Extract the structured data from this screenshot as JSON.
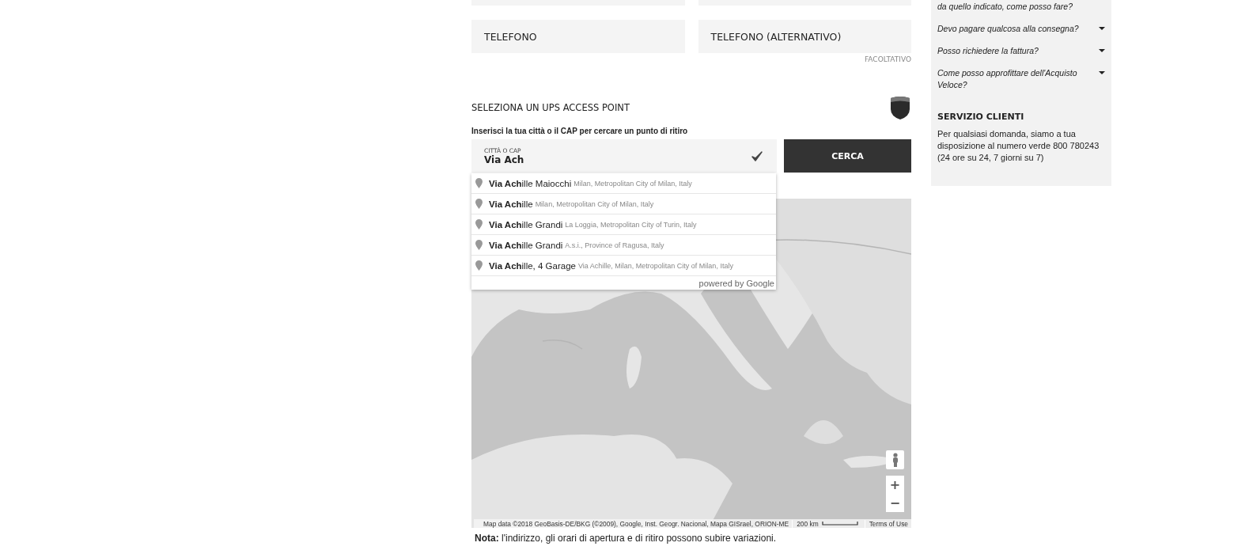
{
  "phone_fields": [
    {
      "label": "TELEFONO"
    },
    {
      "label": "TELEFONO (ALTERNATIVO)",
      "note": "FACOLTATIVO"
    }
  ],
  "access_point": {
    "title": "SELEZIONA UN UPS ACCESS POINT",
    "hint": "Inserisci la tua città o il CAP per cercare un punto di ritiro",
    "field_label": "CITTÀ O CAP",
    "field_value": "Via Ach",
    "valid": true,
    "button": "CERCA"
  },
  "suggestions": [
    {
      "main": "**Via Ach**ille Maiocchi",
      "secondary": "Milan, Metropolitan City of Milan, Italy"
    },
    {
      "main": "**Via Ach**ille",
      "secondary": "Milan, Metropolitan City of Milan, Italy"
    },
    {
      "main": "**Via Ach**ille Grandi",
      "secondary": "La Loggia, Metropolitan City of Turin, Italy"
    },
    {
      "main": "**Via Ach**ille Grandi",
      "secondary": "A.s.i., Province of Ragusa, Italy"
    },
    {
      "main": "**Via Ach**ille, 4 Garage",
      "secondary": "Via Achille, Milan, Metropolitan City of Milan, Italy"
    }
  ],
  "powered_by": "powered by Google",
  "map": {
    "kind": "picture",
    "zoom_in": "+",
    "zoom_out": "−",
    "attribution": "Map data ©2018 GeoBasis-DE/BKG (©2009), Google, Inst. Geogr. Nacional, Mapa GISrael, ORION-ME",
    "scale": "200 km",
    "terms": "Terms of Use"
  },
  "note": "**Nota:** l'indirizzo, gli orari di apertura e di ritiro possono subire variazioni.",
  "sidebar": {
    "faq": [
      {
        "question": "da quello indicato, come posso fare?",
        "expandable": false
      },
      {
        "question": "Devo pagare qualcosa alla consegna?",
        "expandable": true
      },
      {
        "question": "Posso richiedere la fattura?",
        "expandable": true
      },
      {
        "question": "Come posso approfittare dell'Acquisto Veloce?",
        "expandable": true
      }
    ],
    "service_title": "SERVIZIO CLIENTI",
    "service_text": "Per qualsiasi domanda, siamo a tua disposizione al numero verde 800 780243 (24 ore su 24, 7 giorni su 7)"
  }
}
